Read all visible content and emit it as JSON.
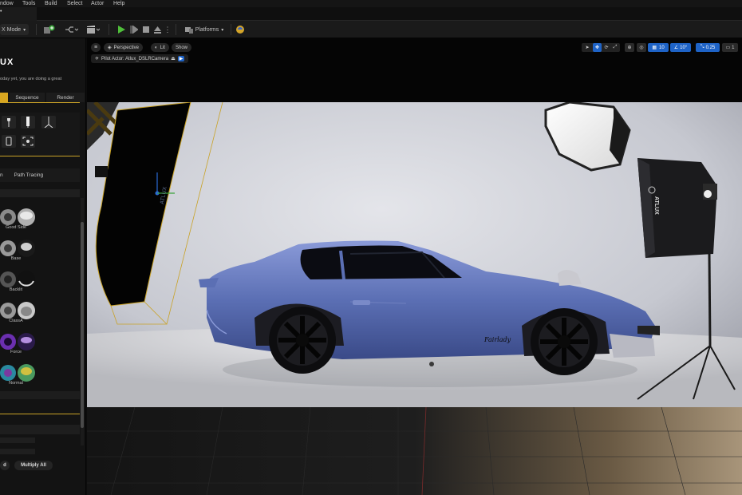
{
  "menu": [
    "ndow",
    "Tools",
    "Build",
    "Select",
    "Actor",
    "Help"
  ],
  "tab": {
    "label": "•"
  },
  "toolbar": {
    "mode_label": "Χ Mode",
    "platforms_label": "Platforms"
  },
  "panel": {
    "logo": "UX",
    "message_line1": "oday yet, you are doing a great",
    "tabs": [
      "",
      "Sequence",
      "Render"
    ],
    "render_tabs": [
      "n",
      "Path Tracing"
    ],
    "presets": [
      {
        "label": "Good Side"
      },
      {
        "label": "Base"
      },
      {
        "label": "Backlit"
      },
      {
        "label": "ClassA"
      },
      {
        "label": "Force"
      },
      {
        "label": "Normal"
      }
    ],
    "bottom_buttons": [
      "d",
      "Multiply All"
    ]
  },
  "viewport": {
    "perspective_label": "Perspective",
    "lit_label": "Lit",
    "show_label": "Show",
    "pilot_label": "Pilot Actor: Atlux_DSLRCamera",
    "grid_value": "10",
    "angle_value": "10°",
    "scale_value": "0.25",
    "camera_speed": "1"
  },
  "scene": {
    "softbox_brand": "ATLUX",
    "flag_brand": "ATLUX",
    "car_script": "Fairlady",
    "car_color": "#5b6fb4",
    "accent_gold": "#c9a227",
    "accent_blue": "#1e63c7"
  }
}
